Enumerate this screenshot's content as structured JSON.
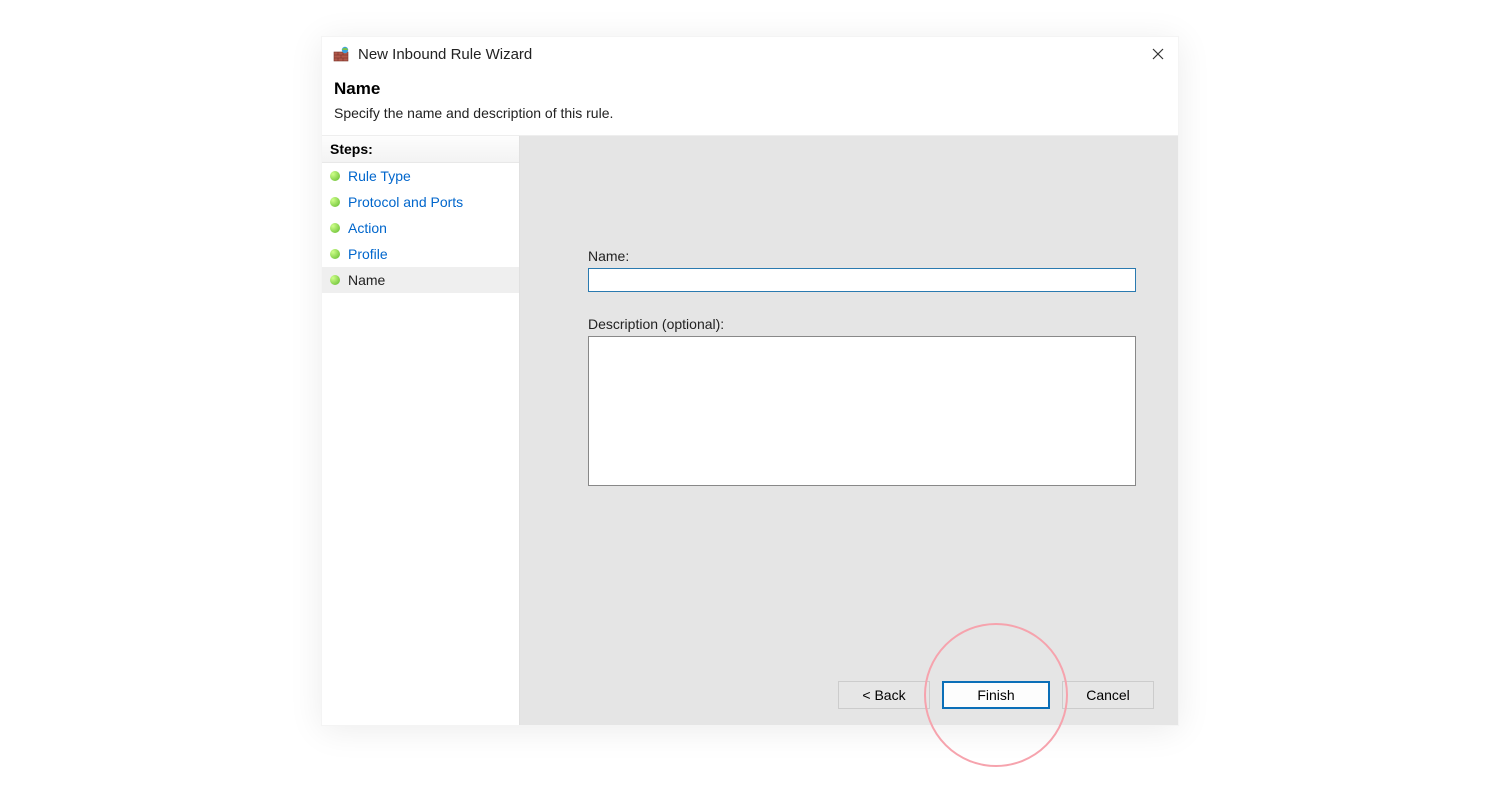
{
  "window": {
    "title": "New Inbound Rule Wizard"
  },
  "header": {
    "title": "Name",
    "subtitle": "Specify the name and description of this rule."
  },
  "steps": {
    "heading": "Steps:",
    "items": [
      {
        "label": "Rule Type",
        "current": false
      },
      {
        "label": "Protocol and Ports",
        "current": false
      },
      {
        "label": "Action",
        "current": false
      },
      {
        "label": "Profile",
        "current": false
      },
      {
        "label": "Name",
        "current": true
      }
    ]
  },
  "form": {
    "name_label": "Name:",
    "name_value": "",
    "desc_label": "Description (optional):",
    "desc_value": ""
  },
  "buttons": {
    "back": "< Back",
    "finish": "Finish",
    "cancel": "Cancel"
  }
}
